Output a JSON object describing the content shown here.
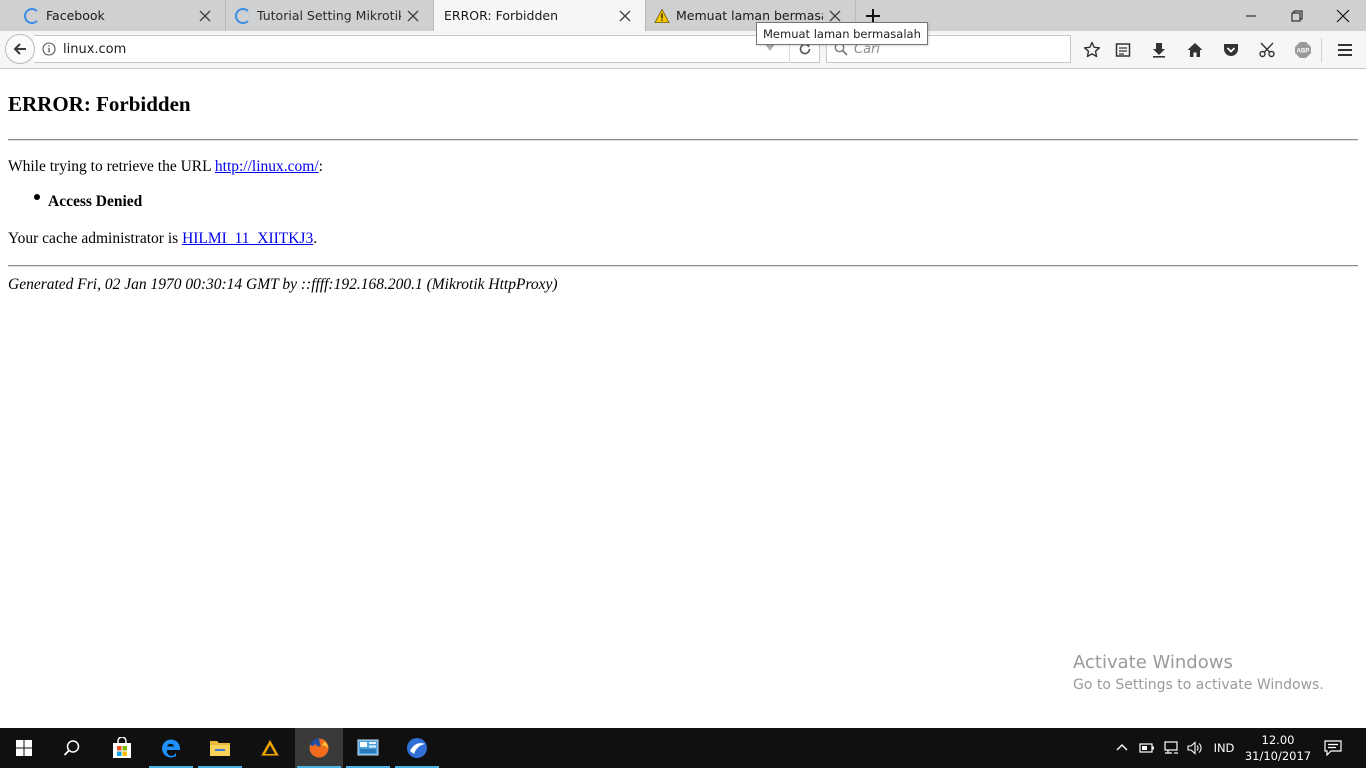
{
  "tabs": [
    {
      "label": "Facebook",
      "icon": "loading-spinner-icon"
    },
    {
      "label": "Tutorial Setting Mikrotik Me",
      "icon": "loading-spinner-icon"
    },
    {
      "label": "ERROR: Forbidden",
      "active": true
    },
    {
      "label": "Memuat laman bermasalah",
      "icon": "warning-icon"
    }
  ],
  "tooltip": "Memuat laman bermasalah",
  "navbar": {
    "url": "linux.com",
    "search_placeholder": "Cari"
  },
  "page": {
    "heading": "ERROR: Forbidden",
    "retrieve_prefix": "While trying to retrieve the URL ",
    "retrieve_link": "http://linux.com/",
    "retrieve_suffix": ":",
    "bullet": "Access Denied",
    "admin_prefix": "Your cache administrator is ",
    "admin_link": "HILMI_11_XIITKJ3",
    "admin_suffix": ".",
    "generated": "Generated Fri, 02 Jan 1970 00:30:14 GMT by ::ffff:192.168.200.1 (Mikrotik HttpProxy)"
  },
  "watermark": {
    "title": "Activate Windows",
    "subtitle": "Go to Settings to activate Windows."
  },
  "taskbar": {
    "apps": [
      "start-icon",
      "search-icon",
      "store-icon",
      "edge-icon",
      "file-explorer-icon",
      "app-icon",
      "firefox-icon",
      "control-panel-icon",
      "network-app-icon"
    ],
    "language": "IND",
    "time": "12.00",
    "date": "31/10/2017"
  },
  "colors": {
    "link": "#0000ee",
    "taskbar": "#101010",
    "accent": "#4cb3e6"
  }
}
